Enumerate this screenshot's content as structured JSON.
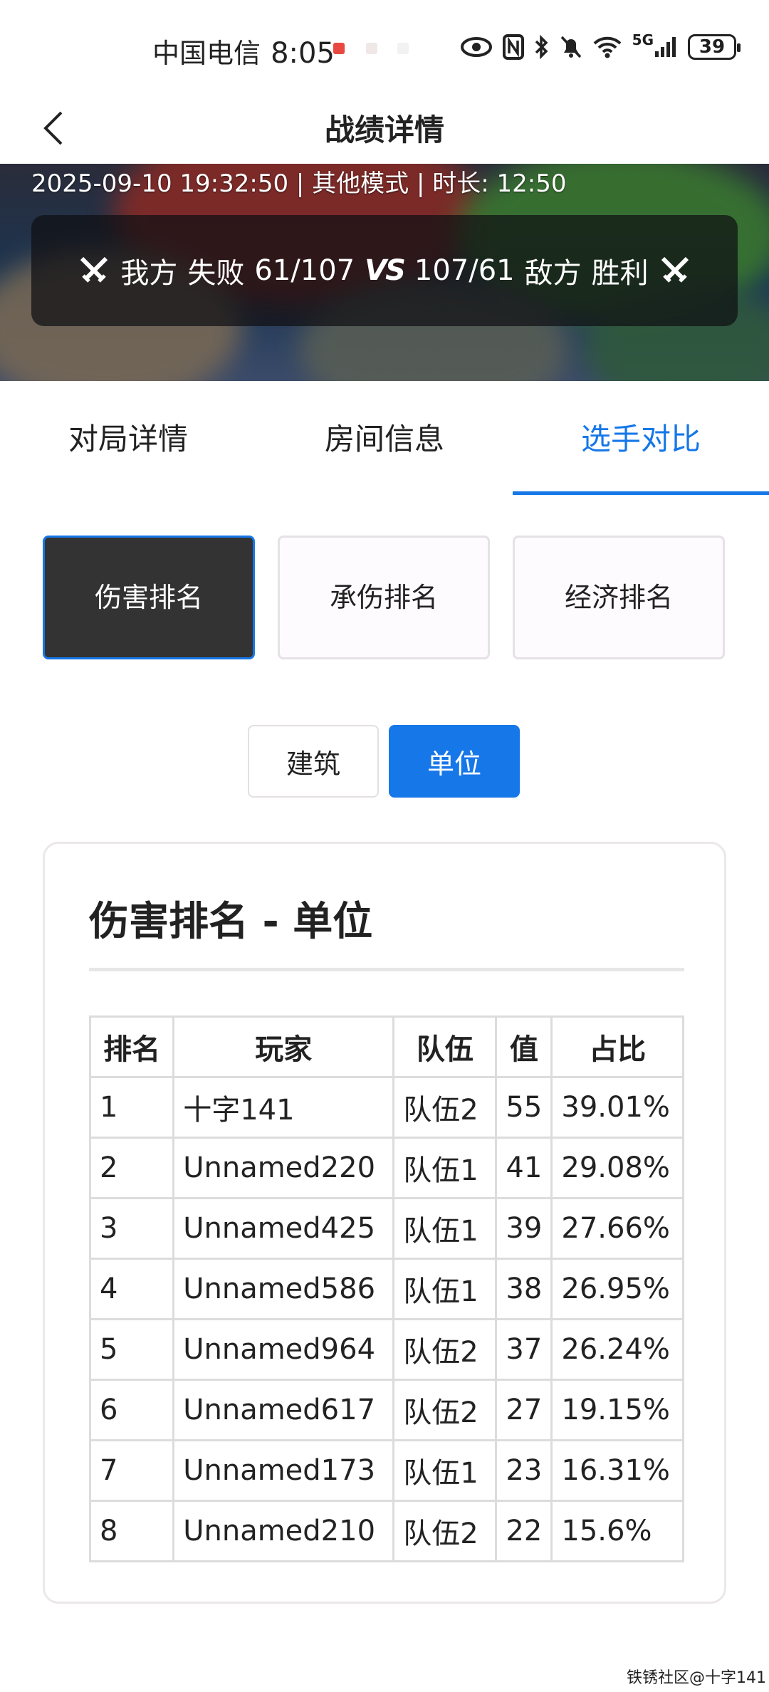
{
  "status_bar": {
    "carrier": "中国电信",
    "time": "8:05",
    "network": "5G",
    "battery": "39"
  },
  "header": {
    "title": "战绩详情"
  },
  "match": {
    "meta": "2025-09-10 19:32:50 | 其他模式 | 时长: 12:50",
    "our_side_label": "我方",
    "our_result": "失败",
    "our_score": "61/107",
    "vs": "VS",
    "enemy_score": "107/61",
    "enemy_side_label": "敌方",
    "enemy_result": "胜利",
    "colors": {
      "loss": "#ff5a57",
      "win": "#32c86c"
    }
  },
  "tabs": [
    {
      "label": "对局详情"
    },
    {
      "label": "房间信息"
    },
    {
      "label": "选手对比"
    }
  ],
  "ranking_buttons": [
    {
      "label": "伤害排名"
    },
    {
      "label": "承伤排名"
    },
    {
      "label": "经济排名"
    }
  ],
  "toggles": [
    {
      "label": "建筑"
    },
    {
      "label": "单位"
    }
  ],
  "card": {
    "title": "伤害排名 - 单位",
    "columns": [
      "排名",
      "玩家",
      "队伍",
      "值",
      "占比"
    ],
    "rows": [
      [
        "1",
        "十字141",
        "队伍2",
        "55",
        "39.01%"
      ],
      [
        "2",
        "Unnamed220",
        "队伍1",
        "41",
        "29.08%"
      ],
      [
        "3",
        "Unnamed425",
        "队伍1",
        "39",
        "27.66%"
      ],
      [
        "4",
        "Unnamed586",
        "队伍1",
        "38",
        "26.95%"
      ],
      [
        "5",
        "Unnamed964",
        "队伍2",
        "37",
        "26.24%"
      ],
      [
        "6",
        "Unnamed617",
        "队伍2",
        "27",
        "19.15%"
      ],
      [
        "7",
        "Unnamed173",
        "队伍1",
        "23",
        "16.31%"
      ],
      [
        "8",
        "Unnamed210",
        "队伍2",
        "22",
        "15.6%"
      ]
    ]
  },
  "watermark": "铁锈社区@十字141",
  "accent_color": "#1677e8"
}
